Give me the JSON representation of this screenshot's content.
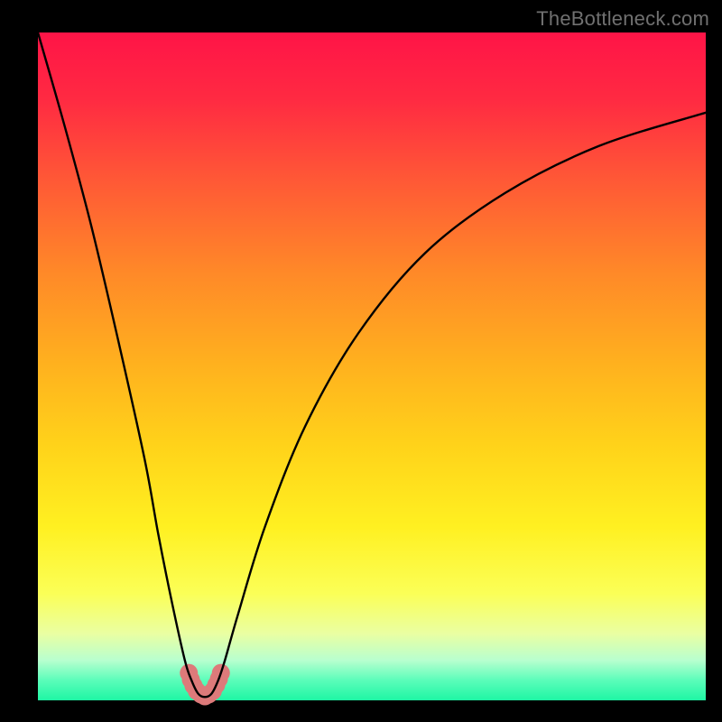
{
  "watermark": "TheBottleneck.com",
  "chart_data": {
    "type": "line",
    "title": "",
    "xlabel": "",
    "ylabel": "",
    "xlim": [
      0,
      100
    ],
    "ylim": [
      0,
      100
    ],
    "series": [
      {
        "name": "curve",
        "x": [
          0,
          4,
          8,
          12,
          16,
          18,
          20,
          22,
          23,
          24,
          25,
          26,
          27,
          28,
          30,
          34,
          40,
          48,
          58,
          70,
          84,
          100
        ],
        "y": [
          100,
          86,
          71,
          54,
          36,
          25,
          15,
          6,
          3,
          1,
          0.5,
          1,
          3,
          6,
          13,
          26,
          41,
          55,
          67,
          76,
          83,
          88
        ]
      }
    ],
    "highlight": {
      "name": "bottom-highlight",
      "color": "#dd7a7a",
      "points_xy": [
        [
          22.6,
          4.1
        ],
        [
          22.9,
          3.1
        ],
        [
          23.3,
          2.2
        ],
        [
          23.8,
          1.4
        ],
        [
          24.4,
          0.9
        ],
        [
          25.0,
          0.6
        ],
        [
          25.6,
          0.9
        ],
        [
          26.2,
          1.4
        ],
        [
          26.7,
          2.3
        ],
        [
          27.1,
          3.2
        ],
        [
          27.4,
          4.1
        ]
      ],
      "radius_px": 10
    },
    "bottom_band": {
      "from_y": 0,
      "to_y": 3.5,
      "color_start": "#1ef6a4",
      "color_end": "#b8ffcf"
    }
  }
}
